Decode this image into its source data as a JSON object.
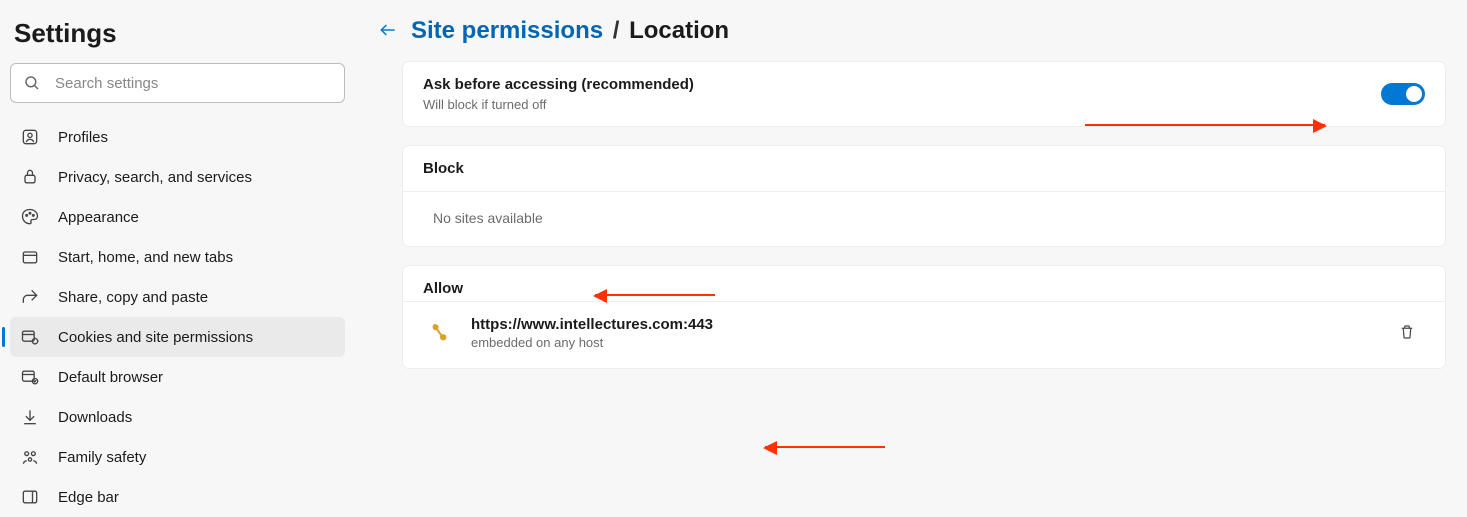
{
  "app": {
    "title": "Settings"
  },
  "search": {
    "placeholder": "Search settings"
  },
  "sidebar": {
    "items": [
      {
        "label": "Profiles",
        "icon": "profiles"
      },
      {
        "label": "Privacy, search, and services",
        "icon": "privacy"
      },
      {
        "label": "Appearance",
        "icon": "appearance"
      },
      {
        "label": "Start, home, and new tabs",
        "icon": "start"
      },
      {
        "label": "Share, copy and paste",
        "icon": "share"
      },
      {
        "label": "Cookies and site permissions",
        "icon": "cookies"
      },
      {
        "label": "Default browser",
        "icon": "default-browser"
      },
      {
        "label": "Downloads",
        "icon": "downloads"
      },
      {
        "label": "Family safety",
        "icon": "family"
      },
      {
        "label": "Edge bar",
        "icon": "edge-bar"
      }
    ]
  },
  "header": {
    "breadcrumb_root": "Site permissions",
    "breadcrumb_sep": "/",
    "breadcrumb_current": "Location"
  },
  "ask": {
    "title": "Ask before accessing (recommended)",
    "subtitle": "Will block if turned off",
    "on": true
  },
  "block": {
    "title": "Block",
    "empty": "No sites available"
  },
  "allow": {
    "title": "Allow",
    "items": [
      {
        "url": "https://www.intellectures.com:443",
        "subtitle": "embedded on any host"
      }
    ]
  }
}
